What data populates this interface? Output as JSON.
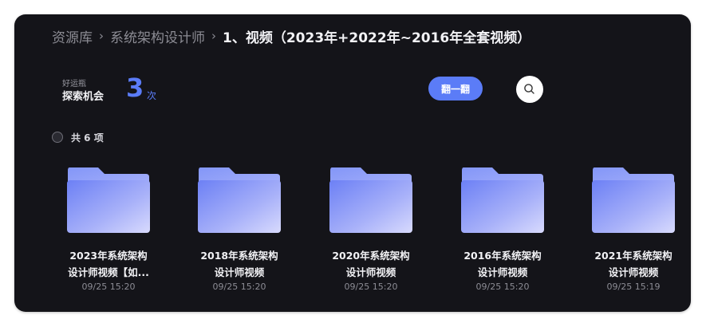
{
  "breadcrumb": {
    "items": [
      "资源库",
      "系统架构设计师",
      "1、视频（2023年+2022年~2016年全套视频）"
    ],
    "separator": "›"
  },
  "chance": {
    "label": "好运瓶",
    "title": "探索机会",
    "count": "3",
    "unit": "次"
  },
  "actions": {
    "flip_label": "翻一翻",
    "search_icon": "search-icon"
  },
  "list": {
    "count_text": "共 6 项"
  },
  "folders": [
    {
      "line1": "2023年系统架构",
      "line2": "设计师视频【如...",
      "date": "09/25 15:20"
    },
    {
      "line1": "2018年系统架构",
      "line2": "设计师视频",
      "date": "09/25 15:20"
    },
    {
      "line1": "2020年系统架构",
      "line2": "设计师视频",
      "date": "09/25 15:20"
    },
    {
      "line1": "2016年系统架构",
      "line2": "设计师视频",
      "date": "09/25 15:20"
    },
    {
      "line1": "2021年系统架构",
      "line2": "设计师视频",
      "date": "09/25 15:19"
    }
  ],
  "colors": {
    "accent": "#5b7cf7",
    "background": "#141419",
    "folder_light": "#c7cdfb",
    "folder_dark": "#6f84f6"
  }
}
